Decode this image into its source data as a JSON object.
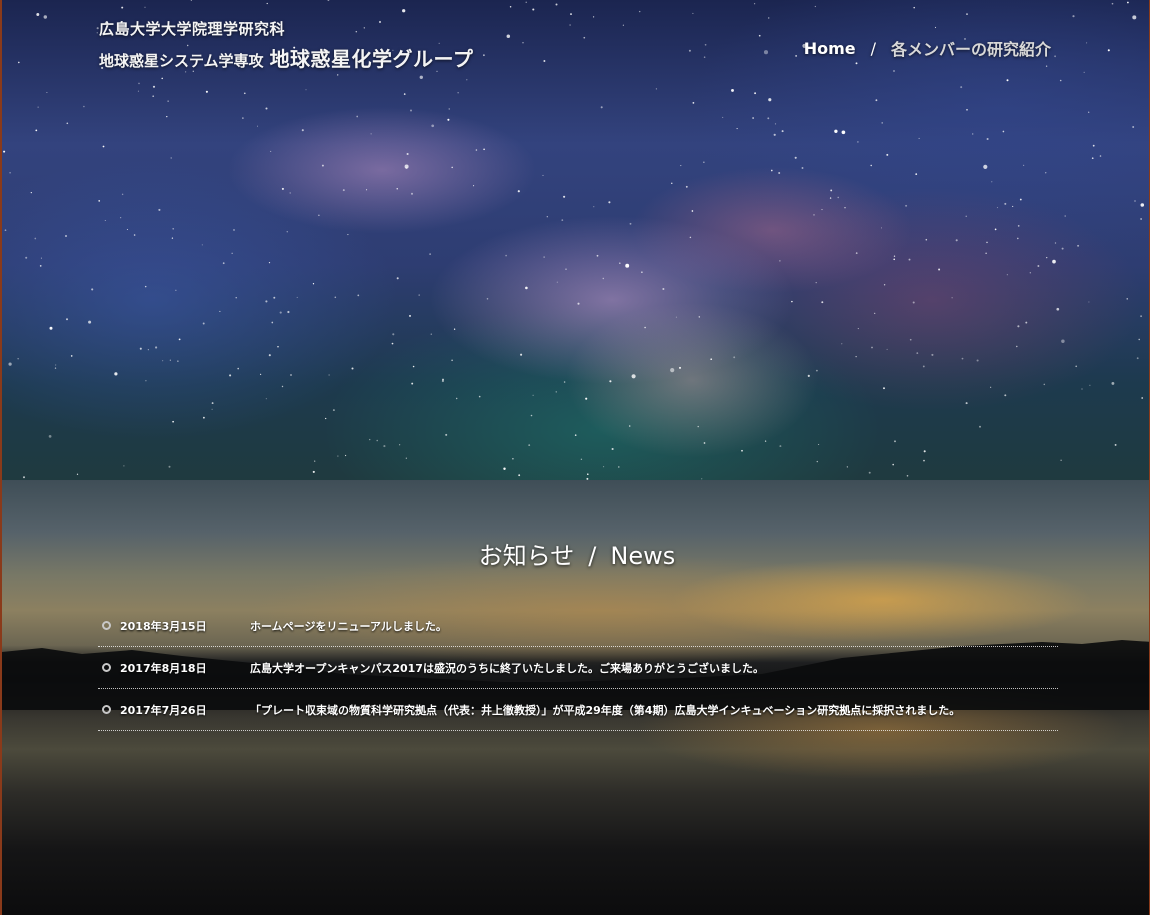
{
  "header": {
    "university_dept": "広島大学大学院理学研究科",
    "major": "地球惑星システム学専攻",
    "group_name": "地球惑星化学グループ"
  },
  "nav": {
    "home_label": "Home",
    "separator": "/",
    "members_label": "各メンバーの研究紹介"
  },
  "news": {
    "title_ja": "お知らせ",
    "title_sep": "/",
    "title_en": "News",
    "items": [
      {
        "date": "2018年3月15日",
        "text": "ホームページをリニューアルしました。"
      },
      {
        "date": "2017年8月18日",
        "text": "広島大学オープンキャンパス2017は盛況のうちに終了いたしました。ご来場ありがとうございました。"
      },
      {
        "date": "2017年7月26日",
        "text": "「プレート収束域の物質科学研究拠点（代表：井上徹教授）」が平成29年度（第4期）広島大学インキュベーション研究拠点に採択されました。"
      }
    ]
  },
  "colors": {
    "text": "#ffffff",
    "bullet": "#c8c8c8",
    "frame": "#8a3a1a"
  }
}
